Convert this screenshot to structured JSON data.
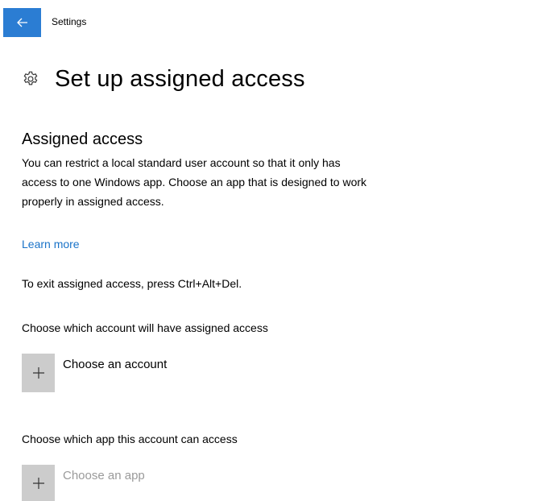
{
  "window": {
    "app_title": "Settings",
    "back_icon": "back-arrow-icon"
  },
  "header": {
    "icon": "gear-icon",
    "title": "Set up assigned access"
  },
  "assigned_access": {
    "title": "Assigned access",
    "description": "You can restrict a local standard user account so that it only has access to one Windows app. Choose an app that is designed to work properly in assigned access.",
    "learn_more": "Learn more",
    "exit_hint": "To exit assigned access, press Ctrl+Alt+Del."
  },
  "account": {
    "label": "Choose which account will have assigned access",
    "button_label": "Choose an account",
    "icon": "plus-icon"
  },
  "app": {
    "label": "Choose which app this account can access",
    "button_label": "Choose an app",
    "icon": "plus-icon"
  },
  "colors": {
    "accent": "#2b7dd3",
    "link": "#1a73c8",
    "tile": "#cccccc",
    "disabled_text": "#9a9a9a"
  }
}
